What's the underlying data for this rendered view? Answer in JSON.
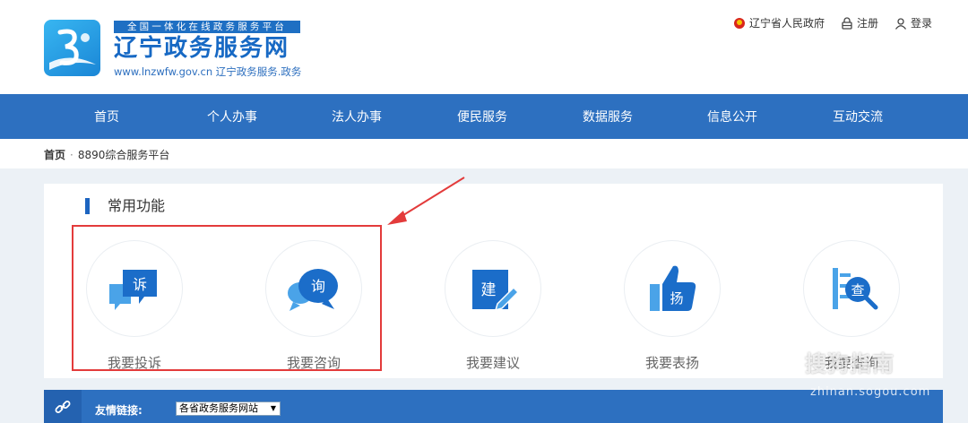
{
  "header": {
    "slogan": "全国一体化在线政务服务平台",
    "site_name": "辽宁政务服务网",
    "site_url": "www.lnzwfw.gov.cn  辽宁政务服务.政务",
    "top_links": {
      "gov": "辽宁省人民政府",
      "register": "注册",
      "login": "登录"
    }
  },
  "nav": [
    "首页",
    "个人办事",
    "法人办事",
    "便民服务",
    "数据服务",
    "信息公开",
    "互动交流"
  ],
  "breadcrumb": {
    "home": "首页",
    "sep": "·",
    "current": "8890综合服务平台"
  },
  "panel": {
    "title": "常用功能",
    "functions": [
      {
        "label": "我要投诉",
        "glyph": "诉",
        "icon": "complaint-icon"
      },
      {
        "label": "我要咨询",
        "glyph": "询",
        "icon": "consult-icon"
      },
      {
        "label": "我要建议",
        "glyph": "建",
        "icon": "suggest-icon"
      },
      {
        "label": "我要表扬",
        "glyph": "扬",
        "icon": "praise-icon"
      },
      {
        "label": "我要查询",
        "glyph": "查",
        "icon": "query-icon"
      }
    ]
  },
  "links": {
    "label": "友情链接:",
    "selected": "各省政务服务网站"
  },
  "watermark": {
    "text": "搜狗指南",
    "url": "zhinan.sogou.com"
  },
  "colors": {
    "brand_blue": "#2d70c0",
    "highlight_red": "#e33b3b",
    "icon_blue": "#1b6dc9"
  }
}
